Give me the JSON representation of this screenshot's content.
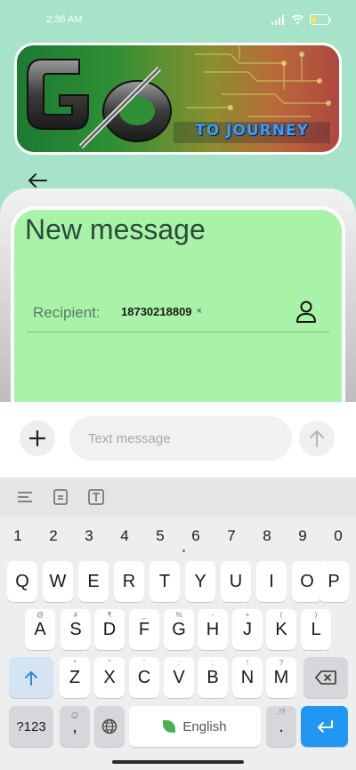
{
  "status_bar": {
    "time": "2:36 AM",
    "signal_icon": "signal-icon",
    "wifi_icon": "wifi-icon",
    "battery_icon": "battery-icon"
  },
  "banner": {
    "logo_text": "TO JOURNEY",
    "logo_letters": "GO"
  },
  "header": {
    "back_icon": "arrow-left-icon",
    "title": "New message"
  },
  "recipient": {
    "label": "Recipient:",
    "chip_value": "18730218809",
    "chip_remove": "×",
    "contact_icon": "person-icon"
  },
  "composer": {
    "add_icon": "plus-icon",
    "placeholder": "Text message",
    "send_icon": "arrow-up-icon"
  },
  "keyboard": {
    "toolbar_icons": [
      "menu-icon",
      "clipboard-icon",
      "text-icon"
    ],
    "number_row": [
      "1",
      "2",
      "3",
      "4",
      "5",
      "6",
      "7",
      "8",
      "9",
      "0"
    ],
    "row1": [
      {
        "key": "Q",
        "hint": ""
      },
      {
        "key": "W",
        "hint": ""
      },
      {
        "key": "E",
        "hint": ""
      },
      {
        "key": "R",
        "hint": ""
      },
      {
        "key": "T",
        "hint": ""
      },
      {
        "key": "Y",
        "hint": ""
      },
      {
        "key": "U",
        "hint": ""
      },
      {
        "key": "I",
        "hint": ""
      },
      {
        "key": "O",
        "hint": ""
      },
      {
        "key": "P",
        "hint": ""
      }
    ],
    "row2": [
      {
        "key": "A",
        "hint": "@"
      },
      {
        "key": "S",
        "hint": "#"
      },
      {
        "key": "D",
        "hint": "₹"
      },
      {
        "key": "F",
        "hint": "_"
      },
      {
        "key": "G",
        "hint": "%"
      },
      {
        "key": "H",
        "hint": "-"
      },
      {
        "key": "J",
        "hint": "+"
      },
      {
        "key": "K",
        "hint": "("
      },
      {
        "key": "L",
        "hint": ")"
      }
    ],
    "row3": [
      {
        "key": "Z",
        "hint": "*"
      },
      {
        "key": "X",
        "hint": "\""
      },
      {
        "key": "C",
        "hint": "'"
      },
      {
        "key": "V",
        "hint": ":"
      },
      {
        "key": "B",
        "hint": ";"
      },
      {
        "key": "N",
        "hint": "!"
      },
      {
        "key": "M",
        "hint": "?"
      }
    ],
    "sym_label": "?123",
    "comma_label": ",",
    "space_label": "English",
    "period_label": ".",
    "period_hint": ",!?",
    "shift_icon": "shift-arrow-icon",
    "backspace_icon": "backspace-icon",
    "globe_icon": "globe-icon",
    "emoji_icon": "emoji-icon",
    "enter_icon": "enter-icon"
  },
  "colors": {
    "background_top": "#a6e3c8",
    "card_green": "#a9f3a9",
    "accent_blue": "#2196f3"
  }
}
